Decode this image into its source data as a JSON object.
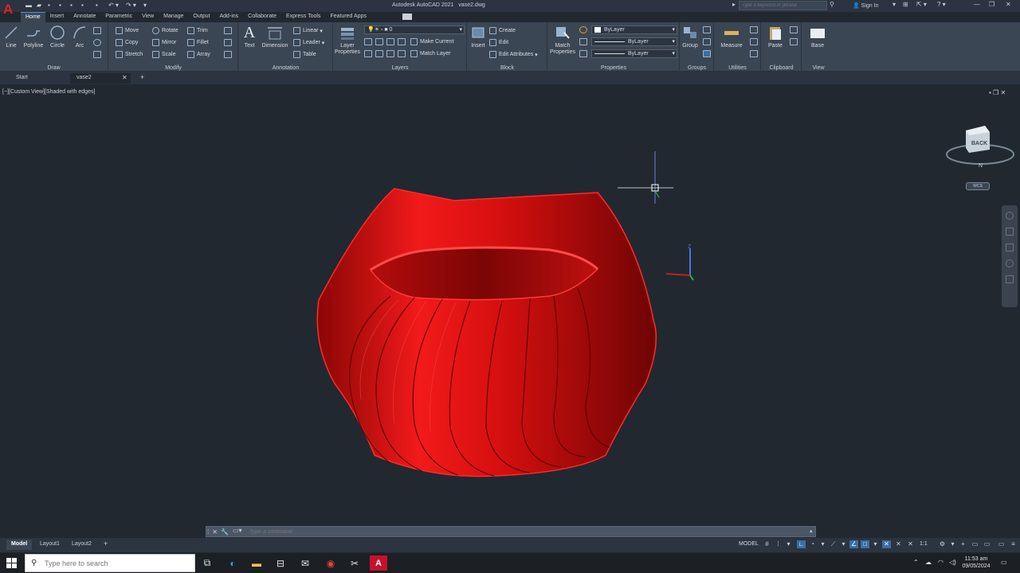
{
  "app": {
    "title": "Autodesk AutoCAD 2021",
    "filename": "vase2.dwg",
    "logo": "A",
    "accent_color": "#e02020"
  },
  "search": {
    "placeholder": "Type a keyword or phrase"
  },
  "account": {
    "sign_in": "Sign In"
  },
  "menu_tabs": [
    "Home",
    "Insert",
    "Annotate",
    "Parametric",
    "View",
    "Manage",
    "Output",
    "Add-ins",
    "Collaborate",
    "Express Tools",
    "Featured Apps"
  ],
  "active_tab": "Home",
  "ribbon": {
    "draw": {
      "title": "Draw",
      "line": "Line",
      "polyline": "Polyline",
      "circle": "Circle",
      "arc": "Arc"
    },
    "modify": {
      "title": "Modify",
      "move": "Move",
      "rotate": "Rotate",
      "trim": "Trim",
      "copy": "Copy",
      "mirror": "Mirror",
      "fillet": "Fillet",
      "stretch": "Stretch",
      "scale": "Scale",
      "array": "Array"
    },
    "annotation": {
      "title": "Annotation",
      "text": "Text",
      "dimension": "Dimension",
      "linear": "Linear",
      "leader": "Leader",
      "table": "Table"
    },
    "layers": {
      "title": "Layers",
      "properties": "Layer Properties",
      "current_layer": "0",
      "make_current": "Make Current",
      "match_layer": "Match Layer"
    },
    "block": {
      "title": "Block",
      "insert": "Insert",
      "create": "Create",
      "edit": "Edit",
      "edit_attributes": "Edit Attributes"
    },
    "properties": {
      "title": "Properties",
      "match": "Match Properties",
      "color": "ByLayer",
      "linetype": "ByLayer",
      "lineweight": "ByLayer"
    },
    "groups": {
      "title": "Groups",
      "group": "Group"
    },
    "utilities": {
      "title": "Utilities",
      "measure": "Measure"
    },
    "clipboard": {
      "title": "Clipboard",
      "paste": "Paste"
    },
    "view": {
      "title": "View",
      "base": "Base"
    }
  },
  "file_tabs": [
    {
      "label": "Start",
      "active": false
    },
    {
      "label": "vase2",
      "active": true
    }
  ],
  "viewport": {
    "label": "[−][Custom View][Shaded with edges]",
    "viewcube_face": "BACK",
    "compass_n": "N",
    "wcs": "WCS",
    "ucs_z": "Z",
    "model_color": "#e01818"
  },
  "command": {
    "placeholder": "Type a command"
  },
  "layout_tabs": [
    {
      "label": "Model",
      "active": true
    },
    {
      "label": "Layout1",
      "active": false
    },
    {
      "label": "Layout2",
      "active": false
    }
  ],
  "status": {
    "space": "MODEL",
    "scale": "1:1"
  },
  "taskbar": {
    "search_placeholder": "Type here to search",
    "time": "11:53 am",
    "date": "09/05/2024"
  }
}
